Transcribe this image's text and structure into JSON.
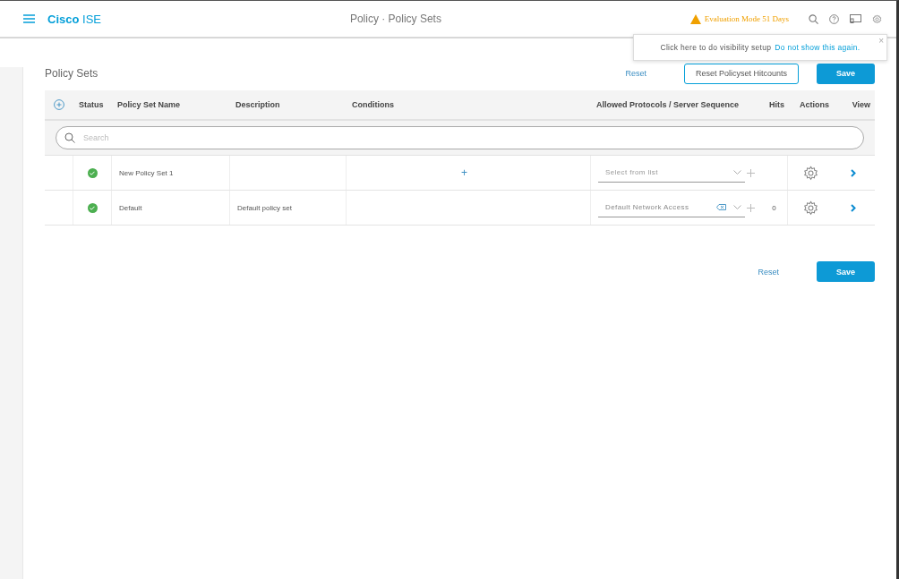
{
  "header": {
    "brand_bold": "Cisco",
    "brand_light": "ISE",
    "title": "Policy · Policy Sets",
    "evaluation": "Evaluation Mode 51 Days"
  },
  "popover": {
    "text": "Click here to do visibility setup",
    "link": "Do not show this again.",
    "close": "×"
  },
  "page": {
    "title": "Policy Sets",
    "reset": "Reset",
    "reset_hitcounts": "Reset Policyset Hitcounts",
    "save": "Save"
  },
  "table": {
    "columns": [
      "Status",
      "Policy Set Name",
      "Description",
      "Conditions",
      "Allowed Protocols / Server Sequence",
      "Hits",
      "Actions",
      "View"
    ],
    "search_placeholder": "Search",
    "rows": [
      {
        "enabled": true,
        "name": "New Policy Set 1",
        "description": "",
        "conditions_add": "+",
        "protocol": "Select from list",
        "protocol_is_placeholder": true,
        "clearable": false,
        "hits": ""
      },
      {
        "enabled": true,
        "name": "Default",
        "description": "Default policy set",
        "conditions_add": "",
        "protocol": "Default Network Access",
        "protocol_is_placeholder": false,
        "clearable": true,
        "hits": "0"
      }
    ]
  },
  "footer": {
    "reset": "Reset",
    "save": "Save"
  }
}
